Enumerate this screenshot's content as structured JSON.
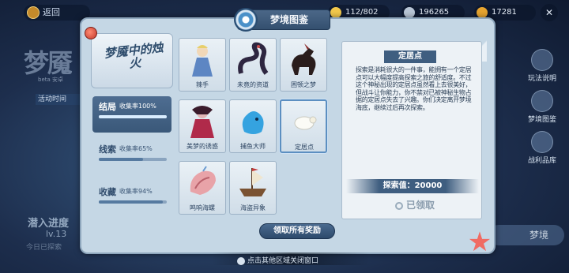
{
  "hud": {
    "back_label": "返回",
    "currency1": "112/802",
    "currency2": "196265",
    "currency3": "17281"
  },
  "background": {
    "title": "梦魇",
    "beta": "beta 安卓",
    "event_time": "活动时间",
    "dive_progress": "潜入进度",
    "dive_level": "lv.13",
    "today_hint": "今日已探索",
    "side_buttons": [
      "玩法说明",
      "梦境图鉴",
      "战利品库"
    ],
    "dream_button": "梦境"
  },
  "panel": {
    "title": "梦境图鉴",
    "badge_text": "梦魇中的烛火",
    "tabs": [
      {
        "label": "结局",
        "rate": "收集率100%",
        "progress": 1.0,
        "active": true
      },
      {
        "label": "线索",
        "rate": "收集率65%",
        "progress": 0.65,
        "active": false
      },
      {
        "label": "收藏",
        "rate": "收集率94%",
        "progress": 0.94,
        "active": false
      }
    ],
    "cards": [
      {
        "name": "辣手",
        "selected": false
      },
      {
        "name": "未竟的资道",
        "selected": false
      },
      {
        "name": "困顿之梦",
        "selected": false
      },
      {
        "name": "美梦的诱惑",
        "selected": false
      },
      {
        "name": "捕鱼大师",
        "selected": false
      },
      {
        "name": "定居点",
        "selected": true
      },
      {
        "name": "鸣响海螺",
        "selected": false
      },
      {
        "name": "海盗异象",
        "selected": false
      }
    ],
    "detail": {
      "title": "定居点",
      "description": "探索是消耗很大的一件事，能拥有一个定居点可以大幅度提高探索之旅的舒适度。不过这个神秘出现的定居点虽然看上去很美好，但战斗让你能力，你不禁对已被神秘生物占据的定居点失去了兴趣。你们决定离开梦境海底，继续过后再次探索。",
      "value_label": "探索值：20000",
      "claimed_label": "已领取"
    },
    "claim_all_label": "领取所有奖励"
  },
  "footer": {
    "hint": "点击其他区域关闭窗口"
  },
  "colors": {
    "panel_bg": "#c5d7e5",
    "accent": "#3f5e80",
    "active_tab": "#4e6d91"
  }
}
